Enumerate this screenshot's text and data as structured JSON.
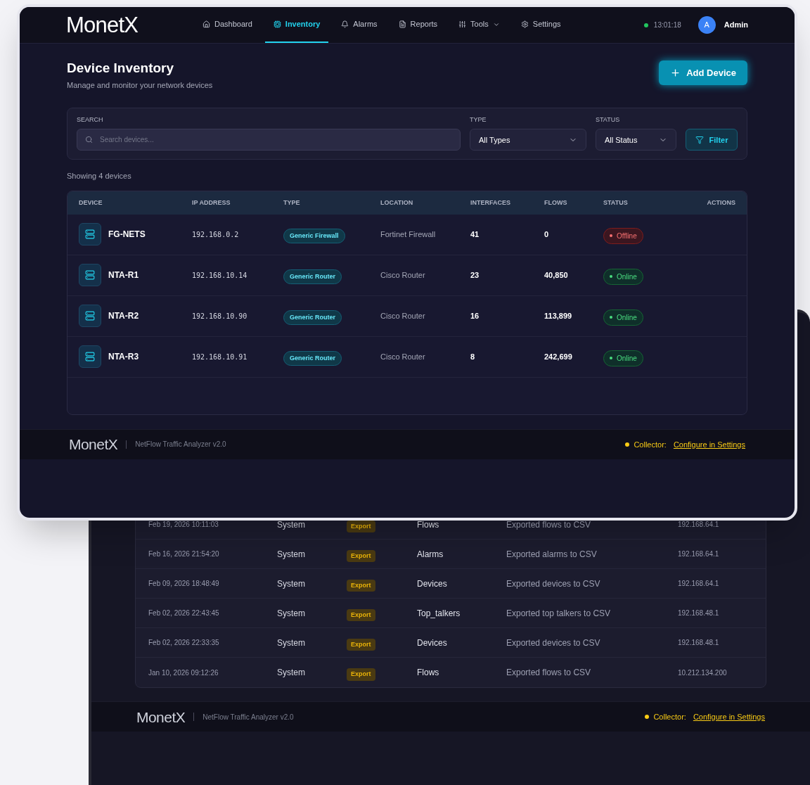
{
  "front_window": {
    "header": {
      "logo": "MonetX",
      "nav": [
        {
          "label": "Dashboard",
          "selected": false,
          "has_menu": false
        },
        {
          "label": "Inventory",
          "selected": true,
          "has_menu": false
        },
        {
          "label": "Alarms",
          "selected": false,
          "has_menu": false
        },
        {
          "label": "Reports",
          "selected": false,
          "has_menu": false
        },
        {
          "label": "Tools",
          "selected": false,
          "has_menu": true
        },
        {
          "label": "Settings",
          "selected": false,
          "has_menu": false
        }
      ],
      "clock": "13:01:18",
      "avatar": "A",
      "user": "Admin"
    },
    "title": "Device Inventory",
    "subtitle": "Manage and monitor your network devices",
    "add_button": "Add Device",
    "filters": {
      "search": {
        "label": "SEARCH",
        "placeholder": "Search devices..."
      },
      "type": {
        "label": "TYPE",
        "value": "All Types"
      },
      "status": {
        "label": "STATUS",
        "value": "All Status"
      },
      "filter_button": "Filter"
    },
    "count": "Showing 4 devices",
    "table": {
      "columns": [
        "DEVICE",
        "IP ADDRESS",
        "TYPE",
        "LOCATION",
        "INTERFACES",
        "FLOWS",
        "STATUS",
        "ACTIONS"
      ],
      "rows": [
        {
          "device": "FG-NETS",
          "ip": "192.168.0.2",
          "type": "Generic Firewall",
          "location": "Fortinet Firewall",
          "interfaces": "41",
          "flows": "0",
          "status": {
            "label": "Offline",
            "kind": "offline"
          }
        },
        {
          "device": "NTA-R1",
          "ip": "192.168.10.14",
          "type": "Generic Router",
          "location": "Cisco Router",
          "interfaces": "23",
          "flows": "40,850",
          "status": {
            "label": "Online",
            "kind": "online"
          }
        },
        {
          "device": "NTA-R2",
          "ip": "192.168.10.90",
          "type": "Generic Router",
          "location": "Cisco Router",
          "interfaces": "16",
          "flows": "113,899",
          "status": {
            "label": "Online",
            "kind": "online"
          }
        },
        {
          "device": "NTA-R3",
          "ip": "192.168.10.91",
          "type": "Generic Router",
          "location": "Cisco Router",
          "interfaces": "8",
          "flows": "242,699",
          "status": {
            "label": "Online",
            "kind": "online"
          }
        }
      ]
    },
    "footer": {
      "logo": "MonetX",
      "product": "NetFlow Traffic Analyzer v2.0",
      "collector_label": "Collector:",
      "collector_link": "Configure in Settings"
    }
  },
  "back_window": {
    "table": {
      "rows": [
        {
          "column_1": "Feb 19, 2026 10:11:03",
          "column_2": "System",
          "column_3": "Export",
          "column_4": "Flows",
          "column_5": "Exported flows to CSV",
          "column_6": "192.168.64.1"
        },
        {
          "column_1": "Feb 16, 2026 21:54:20",
          "column_2": "System",
          "column_3": "Export",
          "column_4": "Alarms",
          "column_5": "Exported alarms to CSV",
          "column_6": "192.168.64.1"
        },
        {
          "column_1": "Feb 09, 2026 18:48:49",
          "column_2": "System",
          "column_3": "Export",
          "column_4": "Devices",
          "column_5": "Exported devices to CSV",
          "column_6": "192.168.64.1"
        },
        {
          "column_1": "Feb 02, 2026 22:43:45",
          "column_2": "System",
          "column_3": "Export",
          "column_4": "Top_talkers",
          "column_5": "Exported top talkers to CSV",
          "column_6": "192.168.48.1"
        },
        {
          "column_1": "Feb 02, 2026 22:33:35",
          "column_2": "System",
          "column_3": "Export",
          "column_4": "Devices",
          "column_5": "Exported devices to CSV",
          "column_6": "192.168.48.1"
        },
        {
          "column_1": "Jan 10, 2026 09:12:26",
          "column_2": "System",
          "column_3": "Export",
          "column_4": "Flows",
          "column_5": "Exported flows to CSV",
          "column_6": "10.212.134.200"
        }
      ]
    },
    "footer": {
      "logo": "MonetX",
      "product": "NetFlow Traffic Analyzer v2.0",
      "collector_label": "Collector:",
      "collector_link": "Configure in Settings"
    }
  }
}
